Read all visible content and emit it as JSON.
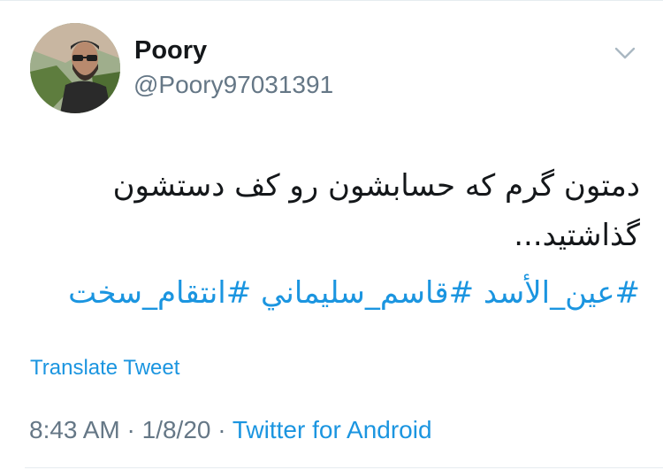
{
  "user": {
    "display_name": "Poory",
    "handle": "@Poory97031391",
    "avatar_icon": "profile-photo"
  },
  "menu": {
    "caret_icon": "chevron-down-icon"
  },
  "tweet": {
    "text": "دمتون گرم که حسابشون رو کف دستشون گذاشتید...",
    "hashtags": [
      "#عين_الأسد",
      "#قاسم_سليماني",
      "#انتقام_سخت"
    ]
  },
  "actions": {
    "translate_label": "Translate Tweet"
  },
  "meta": {
    "time": "8:43 AM",
    "separator": "·",
    "date": "1/8/20",
    "source": "Twitter for Android"
  },
  "colors": {
    "link": "#1b95e0",
    "secondary_text": "#657786",
    "primary_text": "#14171a",
    "divider": "#e6ecf0"
  }
}
